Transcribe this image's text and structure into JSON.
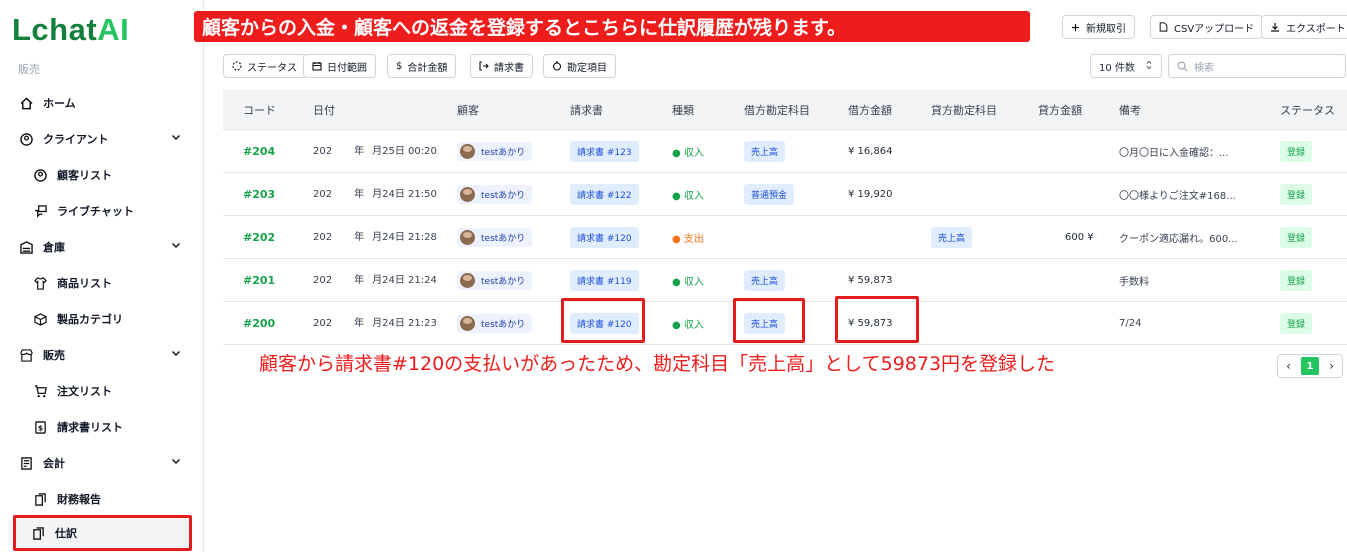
{
  "app": {
    "logo_main": "Lchat",
    "logo_ai": "AI",
    "section_label": "販売"
  },
  "sidebar": {
    "items": [
      {
        "label": "ホーム",
        "icon": "home-icon"
      },
      {
        "label": "クライアント",
        "icon": "user-circle-icon"
      },
      {
        "label": "顧客リスト",
        "icon": "user-circle-icon"
      },
      {
        "label": "ライブチャット",
        "icon": "chat-icon"
      },
      {
        "label": "倉庫",
        "icon": "warehouse-icon"
      },
      {
        "label": "商品リスト",
        "icon": "shirt-icon"
      },
      {
        "label": "製品カテゴリ",
        "icon": "box-icon"
      },
      {
        "label": "販売",
        "icon": "store-icon"
      },
      {
        "label": "注文リスト",
        "icon": "cart-icon"
      },
      {
        "label": "請求書リスト",
        "icon": "invoice-icon"
      },
      {
        "label": "会計",
        "icon": "ledger-icon"
      },
      {
        "label": "財務報告",
        "icon": "report-icon"
      },
      {
        "label": "仕訳",
        "icon": "journal-icon"
      }
    ]
  },
  "annotations": {
    "top_banner": "顧客からの入金・顧客への返金を登録するとこちらに仕訳履歴が残ります。",
    "bottom_note": "顧客から請求書#120の支払いがあったため、勘定科目「売上高」として59873円を登録した"
  },
  "toolbar": {
    "new_entry": "新規取引",
    "csv_upload": "CSVアップロード",
    "export": "エクスポート"
  },
  "filters": {
    "status": "ステータス",
    "date_range": "日付範囲",
    "total_amount": "合計金額",
    "invoice": "請求書",
    "account_item": "勘定項目",
    "per_page": "10 件数",
    "search_placeholder": "検索"
  },
  "table": {
    "headers": [
      "コード",
      "日付",
      "顧客",
      "請求書",
      "種類",
      "借方勘定科目",
      "借方金額",
      "貸方勘定科目",
      "貸方金額",
      "備考",
      "ステータス"
    ],
    "rows": [
      {
        "code": "#204",
        "date_a": "202",
        "date_b": "年",
        "date_c": "月25日 00:20",
        "customer": "testあかり",
        "invoice": "請求書 #123",
        "type": "● 収入",
        "debit_account": "売上高",
        "debit_amount": "¥ 16,864",
        "credit_account": "",
        "credit_amount": "",
        "note": "〇月〇日に入金確認：...",
        "status": "登録"
      },
      {
        "code": "#203",
        "date_a": "202",
        "date_b": "年",
        "date_c": "月24日 21:50",
        "customer": "testあかり",
        "invoice": "請求書 #122",
        "type": "● 収入",
        "debit_account": "普通預金",
        "debit_amount": "¥ 19,920",
        "credit_account": "",
        "credit_amount": "",
        "note": "〇〇様よりご注文#168...",
        "status": "登録"
      },
      {
        "code": "#202",
        "date_a": "202",
        "date_b": "年",
        "date_c": "月24日 21:28",
        "customer": "testあかり",
        "invoice": "請求書 #120",
        "type": "● 支出",
        "debit_account": "",
        "debit_amount": "",
        "credit_account": "売上高",
        "credit_amount": "600 ¥",
        "note": "クーポン適応漏れ。600...",
        "status": "登録"
      },
      {
        "code": "#201",
        "date_a": "202",
        "date_b": "年",
        "date_c": "月24日 21:24",
        "customer": "testあかり",
        "invoice": "請求書 #119",
        "type": "● 収入",
        "debit_account": "売上高",
        "debit_amount": "¥ 59,873",
        "credit_account": "",
        "credit_amount": "",
        "note": "手数料",
        "status": "登録"
      },
      {
        "code": "#200",
        "date_a": "202",
        "date_b": "年",
        "date_c": "月24日 21:23",
        "customer": "testあかり",
        "invoice": "請求書 #120",
        "type": "● 収入",
        "debit_account": "売上高",
        "debit_amount": "¥ 59,873",
        "credit_account": "",
        "credit_amount": "",
        "note": "7/24",
        "status": "登録"
      }
    ]
  },
  "pagination": {
    "current": "1",
    "prev": "‹",
    "next": "›"
  },
  "colors": {
    "brand": "#15803d",
    "accent": "#22c55e",
    "annotation": "#ef1c1c",
    "expense": "#f97316"
  }
}
